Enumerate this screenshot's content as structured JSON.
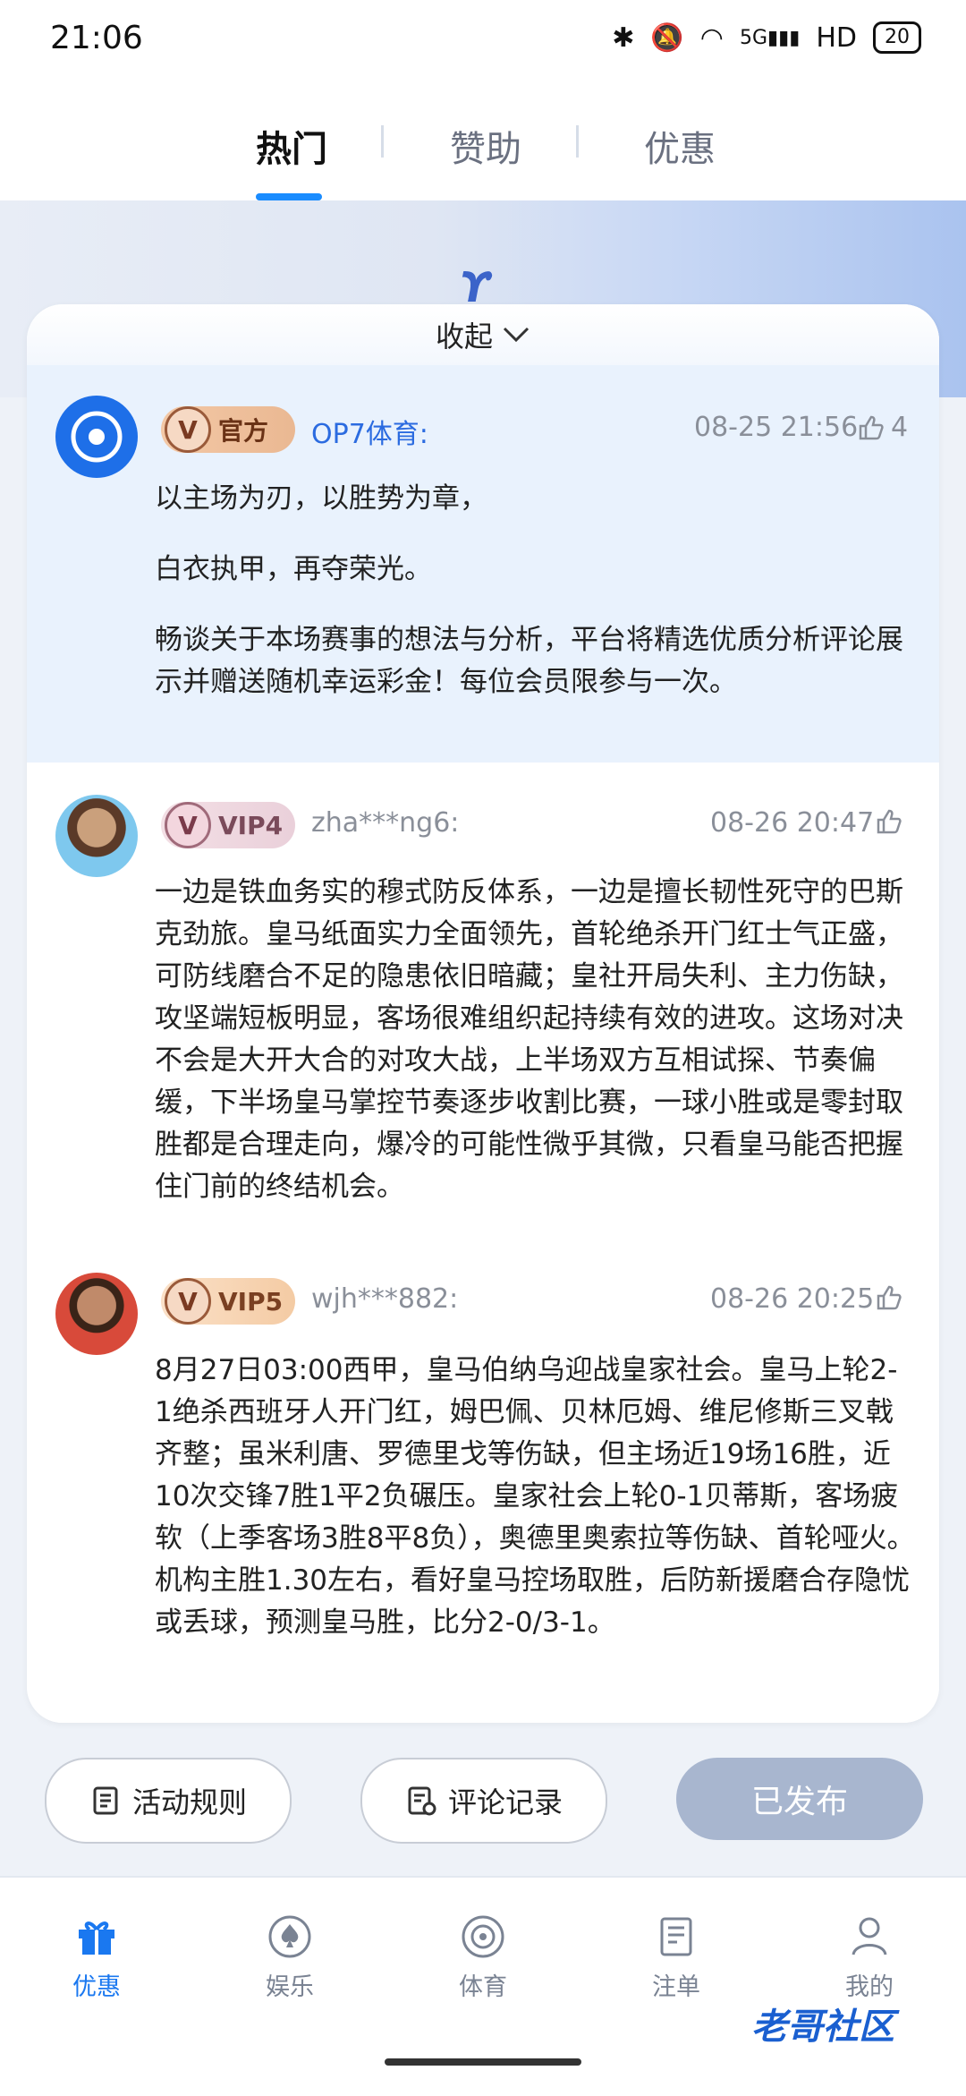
{
  "status": {
    "time": "21:06",
    "network": "5G",
    "hd": "HD",
    "battery": "20"
  },
  "tabs": [
    {
      "label": "热门",
      "active": true
    },
    {
      "label": "赞助",
      "active": false
    },
    {
      "label": "优惠",
      "active": false
    }
  ],
  "panel": {
    "collapse_label": "收起"
  },
  "comments": [
    {
      "badge": "官方",
      "user": "OP7体育:",
      "time": "08-25 21:56",
      "likes": "4",
      "paragraphs": [
        "以主场为刃，以胜势为章，",
        "白衣执甲，再夺荣光。",
        "畅谈关于本场赛事的想法与分析，平台将精选优质分析评论展示并赠送随机幸运彩金！每位会员限参与一次。"
      ]
    },
    {
      "badge": "VIP4",
      "user": "zha***ng6:",
      "time": "08-26 20:47",
      "text": "一边是铁血务实的穆式防反体系，一边是擅长韧性死守的巴斯克劲旅。皇马纸面实力全面领先，首轮绝杀开门红士气正盛，可防线磨合不足的隐患依旧暗藏；皇社开局失利、主力伤缺，攻坚端短板明显，客场很难组织起持续有效的进攻。这场对决不会是大开大合的对攻大战，上半场双方互相试探、节奏偏缓，下半场皇马掌控节奏逐步收割比赛，一球小胜或是零封取胜都是合理走向，爆冷的可能性微乎其微，只看皇马能否把握住门前的终结机会。"
    },
    {
      "badge": "VIP5",
      "user": "wjh***882:",
      "time": "08-26 20:25",
      "text": "8月27日03:00西甲，皇马伯纳乌迎战皇家社会。皇马上轮2-1绝杀西班牙人开门红，姆巴佩、贝林厄姆、维尼修斯三叉戟齐整；虽米利唐、罗德里戈等伤缺，但主场近19场16胜，近10次交锋7胜1平2负碾压。皇家社会上轮0-1贝蒂斯，客场疲软（上季客场3胜8平8负），奥德里奥索拉等伤缺、首轮哑火。机构主胜1.30左右，看好皇马控场取胜，后防新援磨合存隐忧或丢球，预测皇马胜，比分2-0/3-1。"
    }
  ],
  "actions": {
    "rules": "活动规则",
    "history": "评论记录",
    "publish": "已发布"
  },
  "bottom_nav": [
    {
      "label": "优惠",
      "active": true,
      "icon": "gift-icon"
    },
    {
      "label": "娱乐",
      "active": false,
      "icon": "spade-icon"
    },
    {
      "label": "体育",
      "active": false,
      "icon": "soccer-ball-icon"
    },
    {
      "label": "注单",
      "active": false,
      "icon": "document-icon"
    },
    {
      "label": "我的",
      "active": false,
      "icon": "person-icon"
    }
  ],
  "watermark": "老哥社区",
  "colors": {
    "accent": "#1a8cff",
    "official_bg": "#e9f2fd",
    "disabled_button": "#a8b6cf"
  }
}
